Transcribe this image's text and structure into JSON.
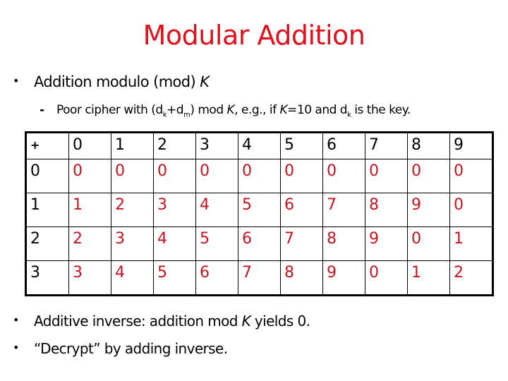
{
  "title": "Modular Addition",
  "bullets": {
    "b1": {
      "text": "Addition modulo (mod) ",
      "var": "K"
    },
    "sub": {
      "p1": "Poor cipher with (d",
      "s1": "k",
      "p2": "+d",
      "s2": "m",
      "p3": ") mod ",
      "v1": "K",
      "p4": ", e.g., if ",
      "v2": "K",
      "p5": "=10 and d",
      "s3": "k",
      "p6": " is the key."
    },
    "b3": {
      "p1": "Additive inverse: addition mod ",
      "var": "K",
      "p2": " yields 0."
    },
    "b4": {
      "text": "“Decrypt” by adding inverse."
    }
  },
  "table": {
    "operator": "+",
    "column_headers": [
      "0",
      "1",
      "2",
      "3",
      "4",
      "5",
      "6",
      "7",
      "8",
      "9"
    ],
    "rows": [
      {
        "header": "0",
        "values": [
          "0",
          "0",
          "0",
          "0",
          "0",
          "0",
          "0",
          "0",
          "0",
          "0"
        ]
      },
      {
        "header": "1",
        "values": [
          "1",
          "2",
          "3",
          "4",
          "5",
          "6",
          "7",
          "8",
          "9",
          "0"
        ]
      },
      {
        "header": "2",
        "values": [
          "2",
          "3",
          "4",
          "5",
          "6",
          "7",
          "8",
          "9",
          "0",
          "1"
        ]
      },
      {
        "header": "3",
        "values": [
          "3",
          "4",
          "5",
          "6",
          "7",
          "8",
          "9",
          "0",
          "1",
          "2"
        ]
      }
    ]
  },
  "colors": {
    "title": "#e0101c",
    "cell_values": "#c8141e",
    "text": "#000000"
  }
}
